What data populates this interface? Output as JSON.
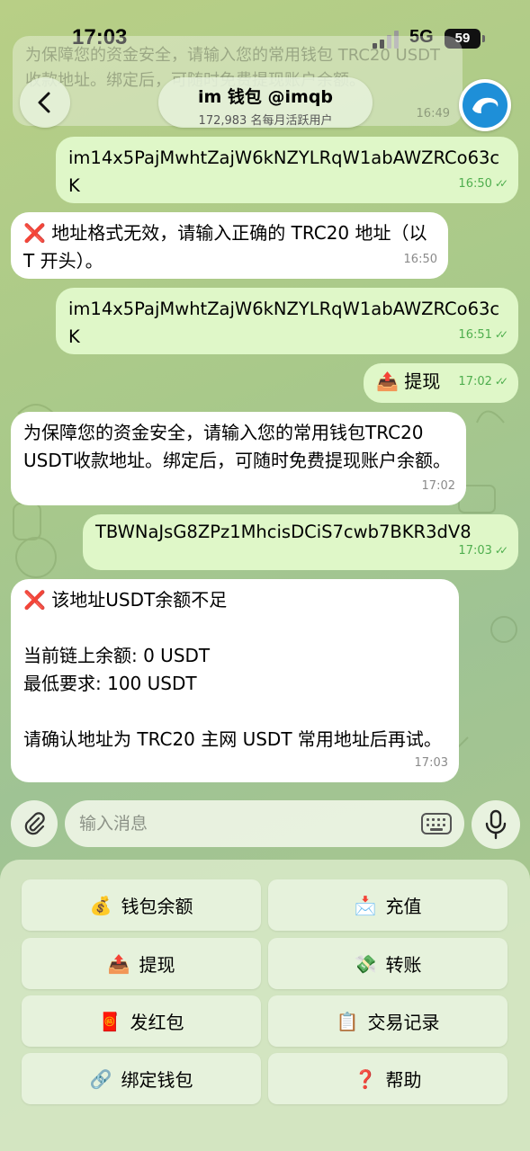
{
  "status": {
    "time": "17:03",
    "network": "5G",
    "battery": "59"
  },
  "header": {
    "title": "im 钱包 @imqb",
    "subtitle": "172,983 名每月活跃用户"
  },
  "ghost_message": {
    "text": "为保障您的资金安全，请输入您的常用钱包 TRC20 USDT收款地址。绑定后，可随时免费提现账户余额。",
    "time": "16:49"
  },
  "messages": [
    {
      "dir": "out",
      "text": "im14x5PajMwhtZajW6kNZYLRqW1abAWZRCo63cK",
      "time": "16:50"
    },
    {
      "dir": "in",
      "icon": "❌",
      "text": "地址格式无效，请输入正确的 TRC20 地址（以 T 开头）。",
      "time": "16:50"
    },
    {
      "dir": "out",
      "text": "im14x5PajMwhtZajW6kNZYLRqW1abAWZRCo63cK",
      "time": "16:51"
    },
    {
      "dir": "out",
      "icon": "📤",
      "text": "提现",
      "time": "17:02"
    },
    {
      "dir": "in",
      "text": "为保障您的资金安全，请输入您的常用钱包TRC20 USDT收款地址。绑定后，可随时免费提现账户余额。",
      "time": "17:02"
    },
    {
      "dir": "out",
      "text": "TBWNaJsG8ZPz1MhcisDCiS7cwb7BKR3dV8",
      "time": "17:03"
    },
    {
      "dir": "in",
      "icon": "❌",
      "line1": "该地址USDT余额不足",
      "line2": "当前链上余额: 0 USDT",
      "line3": "最低要求: 100 USDT",
      "line4": "请确认地址为 TRC20 主网 USDT 常用地址后再试。",
      "time": "17:03"
    }
  ],
  "input": {
    "placeholder": "输入消息"
  },
  "keyboard": [
    {
      "emoji": "💰",
      "label": "钱包余额"
    },
    {
      "emoji": "📩",
      "label": "充值"
    },
    {
      "emoji": "📤",
      "label": "提现"
    },
    {
      "emoji": "💸",
      "label": "转账"
    },
    {
      "emoji": "🧧",
      "label": "发红包"
    },
    {
      "emoji": "📋",
      "label": "交易记录"
    },
    {
      "emoji": "🔗",
      "label": "绑定钱包"
    },
    {
      "emoji": "❓",
      "label": "帮助"
    }
  ],
  "colors": {
    "outgoing_bubble": "#dff7c8",
    "incoming_bubble": "#ffffff",
    "check": "#4fae4e",
    "error": "#e0251c"
  }
}
